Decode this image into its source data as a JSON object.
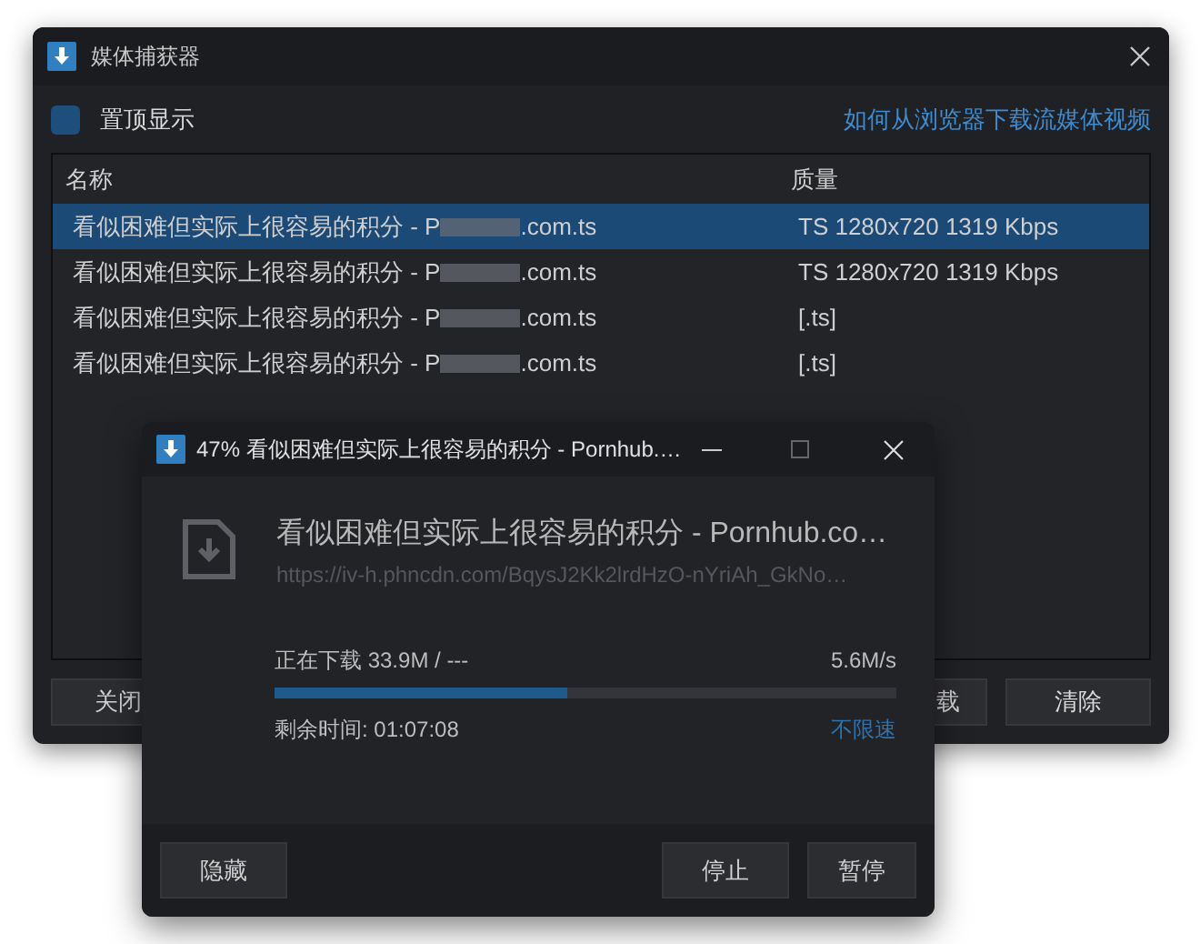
{
  "main_window": {
    "title": "媒体捕获器",
    "pin_on_top": {
      "label": "置顶显示",
      "checked": false
    },
    "help_link": "如何从浏览器下载流媒体视频",
    "table": {
      "columns": [
        "名称",
        "质量"
      ],
      "rows": [
        {
          "name_start": "看似困难但实际上很容易的积分 - P",
          "name_end": ".com.ts",
          "quality": "TS 1280x720 1319 Kbps",
          "selected": true
        },
        {
          "name_start": "看似困难但实际上很容易的积分 - P",
          "name_end": ".com.ts",
          "quality": "TS 1280x720 1319 Kbps",
          "selected": false
        },
        {
          "name_start": "看似困难但实际上很容易的积分 - P",
          "name_end": ".com.ts",
          "quality": "[.ts]",
          "selected": false
        },
        {
          "name_start": "看似困难但实际上很容易的积分 - P",
          "name_end": ".com.ts",
          "quality": "[.ts]",
          "selected": false
        }
      ]
    },
    "buttons": [
      "关闭",
      "载",
      "清除"
    ]
  },
  "download_dialog": {
    "title": "47% 看似困难但实际上很容易的积分 - Pornhub.…",
    "file_name": "看似困难但实际上很容易的积分 - Pornhub.co…",
    "url": "https://iv-h.phncdn.com/BqysJ2Kk2lrdHzO-nYriAh_GkNo…",
    "status": "正在下载 33.9M / ---",
    "speed": "5.6M/s",
    "level": 0.47,
    "remaining": "剩余时间: 01:07:08",
    "speed_limit": "不限速",
    "buttons": [
      "隐藏",
      "停止",
      "暂停"
    ]
  }
}
